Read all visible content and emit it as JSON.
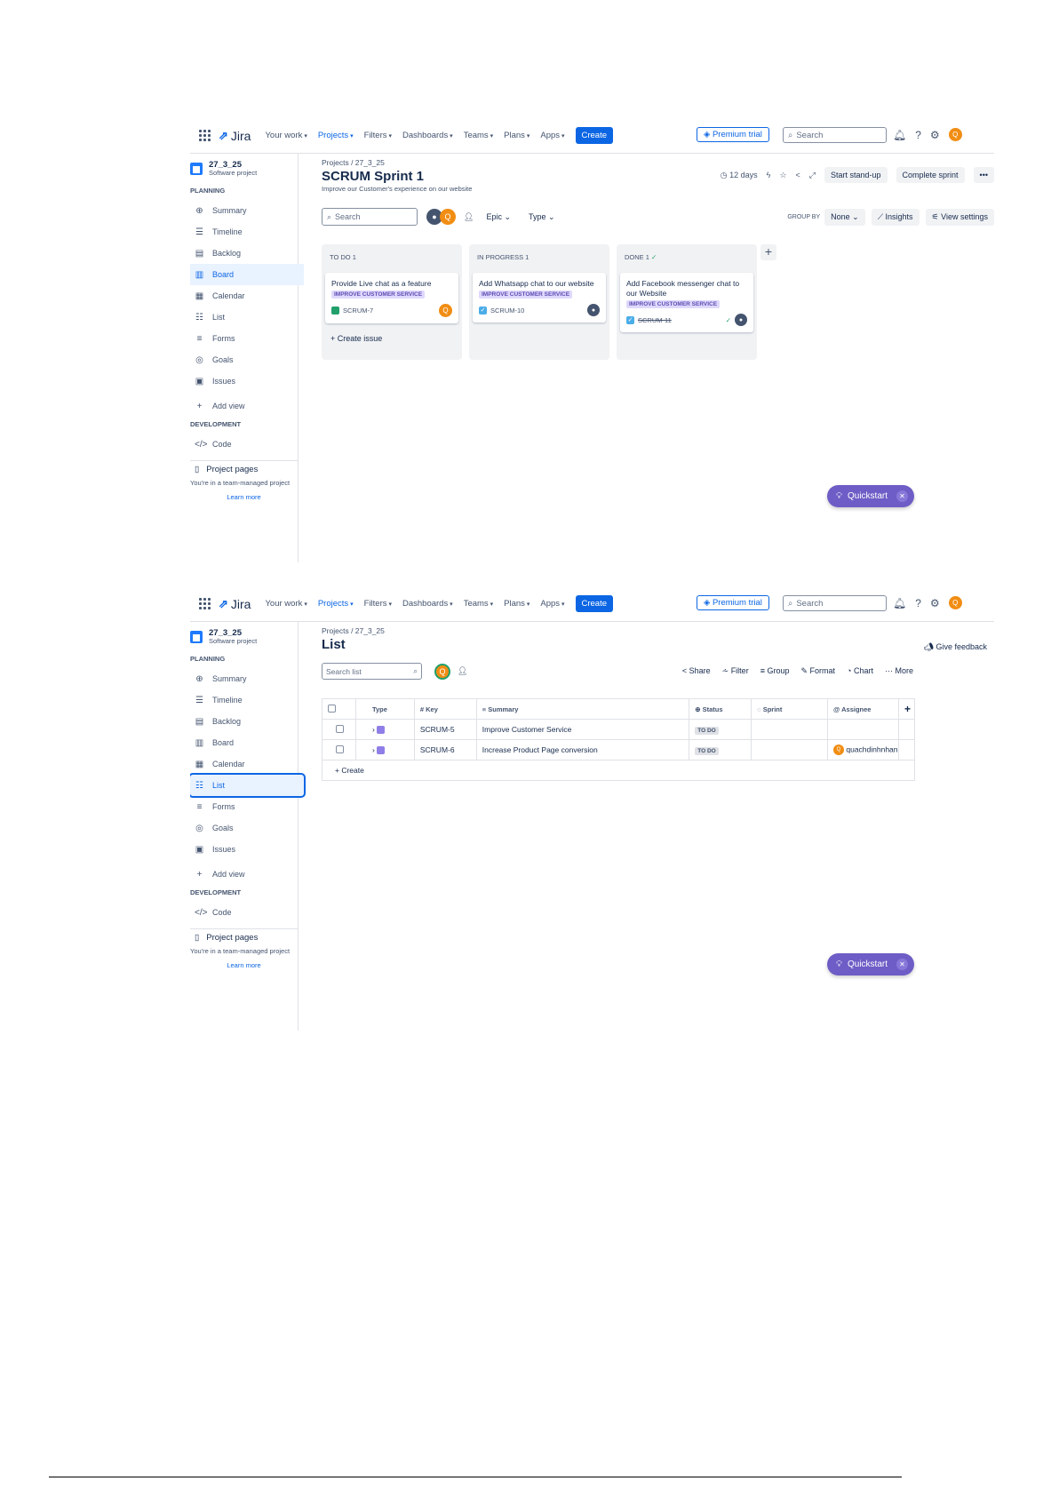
{
  "nav": {
    "logo": "Jira",
    "items": [
      "Your work",
      "Projects",
      "Filters",
      "Dashboards",
      "Teams",
      "Plans",
      "Apps"
    ],
    "create": "Create",
    "premium": "Premium trial",
    "search_placeholder": "Search",
    "user_initial": "Q"
  },
  "sidebar": {
    "project_name": "27_3_25",
    "project_type": "Software project",
    "planning_label": "PLANNING",
    "items": [
      "Summary",
      "Timeline",
      "Backlog",
      "Board",
      "Calendar",
      "List",
      "Forms",
      "Goals",
      "Issues"
    ],
    "add_view": "Add view",
    "development_label": "DEVELOPMENT",
    "code": "Code",
    "project_pages": "Project pages",
    "team_managed": "You're in a team-managed project",
    "learn_more": "Learn more"
  },
  "board": {
    "breadcrumb": "Projects  /  27_3_25",
    "title": "SCRUM Sprint 1",
    "description": "Improve our Customer's experience on our website",
    "days": "12 days",
    "start_standup": "Start stand-up",
    "complete_sprint": "Complete sprint",
    "search_placeholder": "Search",
    "epic": "Epic",
    "type": "Type",
    "group_by_label": "GROUP BY",
    "group_by_value": "None",
    "insights": "Insights",
    "view_settings": "View settings",
    "columns": [
      {
        "header": "TO DO 1",
        "card": {
          "title": "Provide Live chat as a feature",
          "epic": "IMPROVE CUSTOMER SERVICE",
          "key": "SCRUM-7"
        }
      },
      {
        "header": "IN PROGRESS 1",
        "card": {
          "title": "Add Whatsapp chat to our website",
          "epic": "IMPROVE CUSTOMER SERVICE",
          "key": "SCRUM-10"
        }
      },
      {
        "header": "DONE 1",
        "card": {
          "title": "Add Facebook messenger chat to our Website",
          "epic": "IMPROVE CUSTOMER SERVICE",
          "key": "SCRUM-11"
        }
      }
    ],
    "create_issue": "Create issue"
  },
  "list": {
    "breadcrumb": "Projects  /  27_3_25",
    "title": "List",
    "give_feedback": "Give feedback",
    "search_placeholder": "Search list",
    "actions": [
      "Share",
      "Filter",
      "Group",
      "Format",
      "Chart",
      "More"
    ],
    "headers": [
      "Type",
      "Key",
      "Summary",
      "Status",
      "Sprint",
      "Assignee"
    ],
    "rows": [
      {
        "key": "SCRUM-5",
        "summary": "Improve Customer Service",
        "status": "TO DO",
        "sprint": "",
        "assignee": ""
      },
      {
        "key": "SCRUM-6",
        "summary": "Increase Product Page conversion",
        "status": "TO DO",
        "sprint": "",
        "assignee": "quachdinhnhan"
      }
    ],
    "create": "Create"
  },
  "quickstart": "Quickstart",
  "colors": {
    "primary": "#0c66e4",
    "quickstart": "#6e5dc6",
    "epic_lozenge": "#dfd8fd",
    "avatar": "#f18d13"
  }
}
